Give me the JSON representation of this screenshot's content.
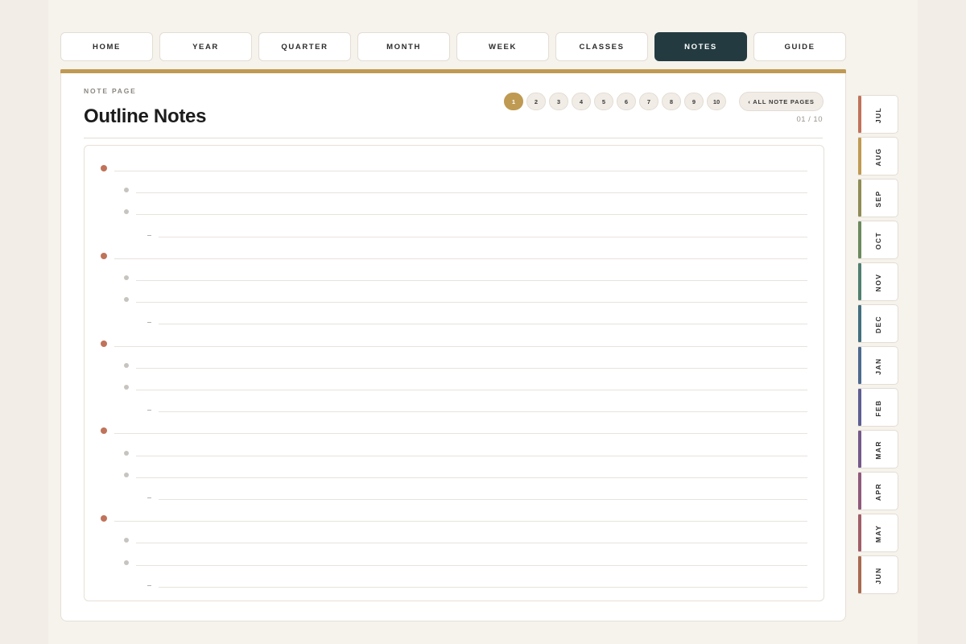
{
  "nav": {
    "tabs": [
      {
        "label": "HOME",
        "active": false
      },
      {
        "label": "YEAR",
        "active": false
      },
      {
        "label": "QUARTER",
        "active": false
      },
      {
        "label": "MONTH",
        "active": false
      },
      {
        "label": "WEEK",
        "active": false
      },
      {
        "label": "CLASSES",
        "active": false
      },
      {
        "label": "NOTES",
        "active": true
      },
      {
        "label": "GUIDE",
        "active": false
      }
    ]
  },
  "page": {
    "eyebrow": "NOTE PAGE",
    "title": "Outline Notes",
    "page_counter": "01 / 10",
    "all_pages_label": "‹ ALL NOTE PAGES",
    "current_page": 1,
    "pages": [
      "1",
      "2",
      "3",
      "4",
      "5",
      "6",
      "7",
      "8",
      "9",
      "10"
    ]
  },
  "outline": {
    "group_count": 5,
    "pattern": [
      "main-bullet",
      "sub-bullet",
      "sub-bullet",
      "dash"
    ]
  },
  "months": [
    {
      "label": "JUL",
      "color": "#c0735a"
    },
    {
      "label": "AUG",
      "color": "#bf9a52"
    },
    {
      "label": "SEP",
      "color": "#8f8c55"
    },
    {
      "label": "OCT",
      "color": "#6b8a5e"
    },
    {
      "label": "NOV",
      "color": "#4f7f6f"
    },
    {
      "label": "DEC",
      "color": "#436f7f"
    },
    {
      "label": "JAN",
      "color": "#4d6a8f"
    },
    {
      "label": "FEB",
      "color": "#5e5e92"
    },
    {
      "label": "MAR",
      "color": "#74598a"
    },
    {
      "label": "APR",
      "color": "#8f5a7a"
    },
    {
      "label": "MAY",
      "color": "#a05e68"
    },
    {
      "label": "JUN",
      "color": "#a86a50"
    }
  ],
  "colors": {
    "accent_gold": "#bf9a52",
    "active_tab": "#233b40",
    "bullet_main": "#c0735a",
    "bullet_sub": "#c7c4c0",
    "background": "#f2ede6"
  }
}
